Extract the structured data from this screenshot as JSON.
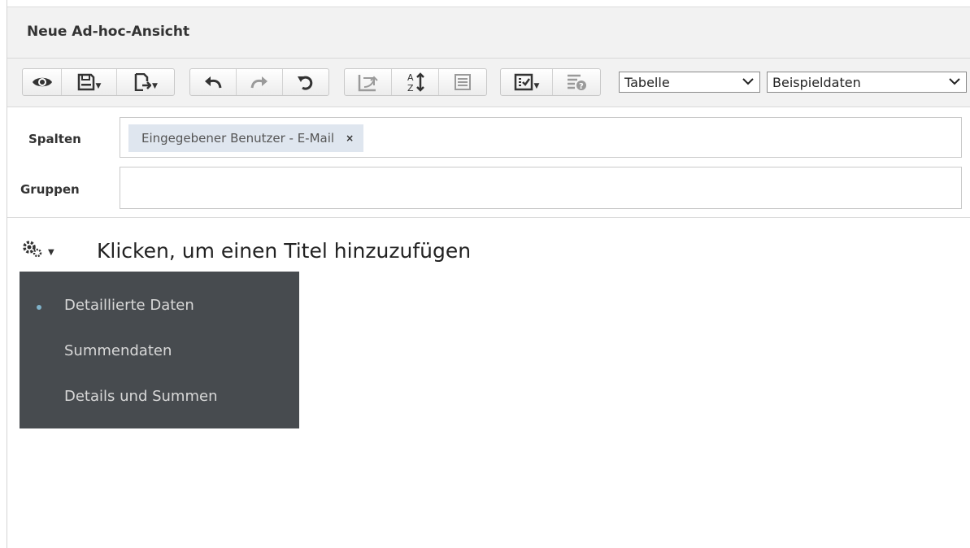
{
  "window": {
    "title": "Neue Ad-hoc-Ansicht"
  },
  "toolbar": {
    "buttons": [
      {
        "name": "view",
        "icon": "eye-icon"
      },
      {
        "name": "save",
        "icon": "save-icon",
        "has_menu": true
      },
      {
        "name": "export",
        "icon": "export-icon",
        "has_menu": true
      },
      {
        "name": "undo",
        "icon": "undo-icon"
      },
      {
        "name": "redo",
        "icon": "redo-icon"
      },
      {
        "name": "undo-all",
        "icon": "undo-all-icon"
      },
      {
        "name": "switch-axes",
        "icon": "switch-axes-icon"
      },
      {
        "name": "sort",
        "icon": "sort-az-icon"
      },
      {
        "name": "query-view",
        "icon": "query-icon"
      },
      {
        "name": "options",
        "icon": "checklist-icon",
        "has_menu": true
      },
      {
        "name": "input-controls",
        "icon": "input-controls-icon"
      }
    ],
    "view_type_select": {
      "selected": "Tabelle"
    },
    "data_select": {
      "selected": "Beispieldaten"
    }
  },
  "fields": {
    "columns_label": "Spalten",
    "columns_chip": "Eingegebener Benutzer - E-Mail",
    "columns_chip_remove": "×",
    "groups_label": "Gruppen"
  },
  "report": {
    "title_placeholder": "Klicken, um einen Titel hinzuzufügen",
    "menu": {
      "items": [
        {
          "label": "Detaillierte Daten",
          "selected": true
        },
        {
          "label": "Summendaten",
          "selected": false
        },
        {
          "label": "Details und Summen",
          "selected": false
        }
      ]
    }
  },
  "colors": {
    "menu_bg": "#474b4f",
    "menu_text": "#d8d8d8",
    "selected_dot": "#7fb2c9",
    "chip_bg": "#dfe6ef",
    "toolbar_bg": "#f2f2f2"
  }
}
